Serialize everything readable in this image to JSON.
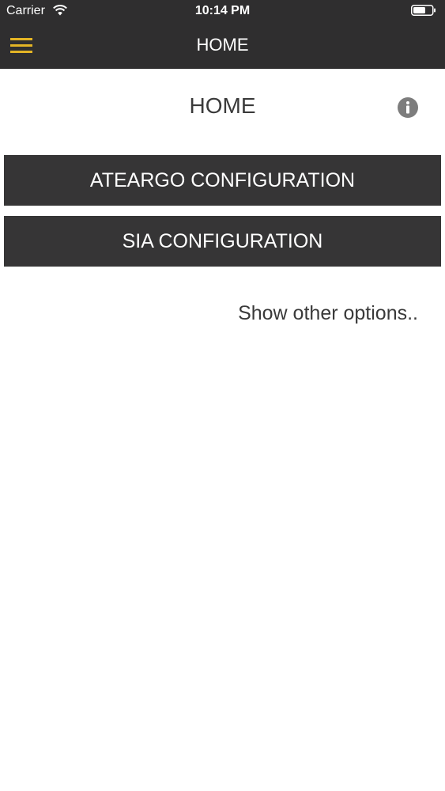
{
  "status_bar": {
    "carrier": "Carrier",
    "time": "10:14 PM",
    "wifi_icon": "wifi-icon",
    "battery_icon": "battery-icon"
  },
  "nav_bar": {
    "title": "HOME",
    "menu_icon": "hamburger-menu-icon",
    "menu_icon_color": "#e3b425",
    "background": "#2f2e2f"
  },
  "main": {
    "title": "HOME",
    "info_icon": "info-icon",
    "buttons": [
      {
        "label": "ATEARGO CONFIGURATION"
      },
      {
        "label": "SIA CONFIGURATION"
      }
    ],
    "other_options_link": "Show other options.."
  }
}
